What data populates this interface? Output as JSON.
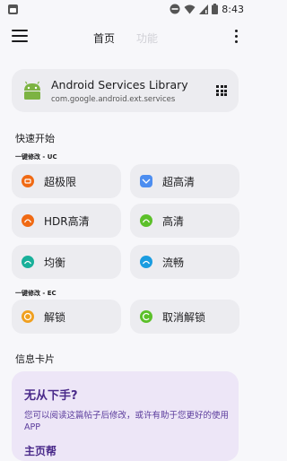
{
  "status_bar": {
    "time": "8:43"
  },
  "header": {
    "tab_home": "首页",
    "tab_functions": "功能"
  },
  "app_card": {
    "title": "Android Services Library",
    "package": "com.google.android.ext.services"
  },
  "quick_start": {
    "title": "快速开始",
    "uc_group": {
      "title": "一键修改 - UC",
      "options": [
        {
          "label": "超极限",
          "color": "#f06a14"
        },
        {
          "label": "超高清",
          "color": "#4d8ef0"
        },
        {
          "label": "HDR高清",
          "color": "#f06a14"
        },
        {
          "label": "高清",
          "color": "#5cc02a"
        },
        {
          "label": "均衡",
          "color": "#19b09a"
        },
        {
          "label": "流畅",
          "color": "#1a9ce0"
        }
      ]
    },
    "ec_group": {
      "title": "一键修改 - EC",
      "options": [
        {
          "label": "解锁",
          "color": "#f0a020"
        },
        {
          "label": "取消解锁",
          "color": "#5cc02a"
        }
      ]
    }
  },
  "info_cards": {
    "title": "信息卡片",
    "card": {
      "title": "无从下手?",
      "text": "您可以阅读这篇帖子后修改，或许有助于您更好的使用APP",
      "more": "主页帮"
    }
  },
  "colors": {
    "android_green": "#7cb342",
    "info_card_bg": "#ede6f7",
    "info_card_text": "#5b3c9c"
  }
}
